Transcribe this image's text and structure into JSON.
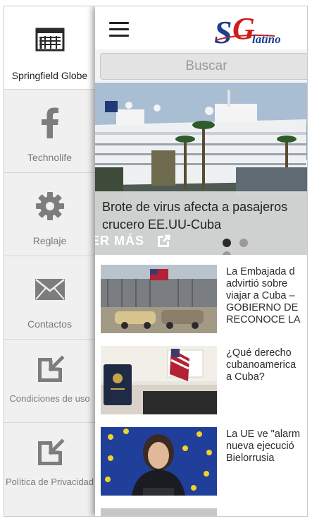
{
  "drawer": {
    "items": [
      {
        "label": "Springfield Globe",
        "icon": "newspaper-icon"
      },
      {
        "label": "Technolife",
        "icon": "facebook-icon"
      },
      {
        "label": "Reglaje",
        "icon": "gear-icon"
      },
      {
        "label": "Contactos",
        "icon": "mail-icon"
      },
      {
        "label": "Condiciones de uso",
        "icon": "external-link-icon"
      },
      {
        "label": "Política de Privacidad",
        "icon": "external-link-icon"
      }
    ]
  },
  "header": {
    "logo_letters": "SG",
    "logo_word": "latino"
  },
  "search": {
    "placeholder": "Buscar"
  },
  "hero": {
    "title_line1": "Brote de virus afecta a pasajeros",
    "title_line2": "crucero EE.UU-Cuba",
    "more_label": "ER MÁS",
    "slide_count": 3,
    "active_slide": 1
  },
  "news": [
    {
      "title": "La Embajada d\nadvirtió sobre\nviajar a Cuba –\nGOBIERNO DE\nRECONOCE LA",
      "image": "cuba-street-flag"
    },
    {
      "title": "¿Qué derecho\ncubanoamerica\na Cuba?",
      "image": "passport-flag"
    },
    {
      "title": "La UE ve \"alarm\nnueva ejecució\nBielorrusia",
      "image": "eu-official"
    }
  ],
  "colors": {
    "drawer_bg": "#f0f0f0",
    "accent_red": "#d01c1c",
    "logo_blue": "#1a3f8f"
  }
}
